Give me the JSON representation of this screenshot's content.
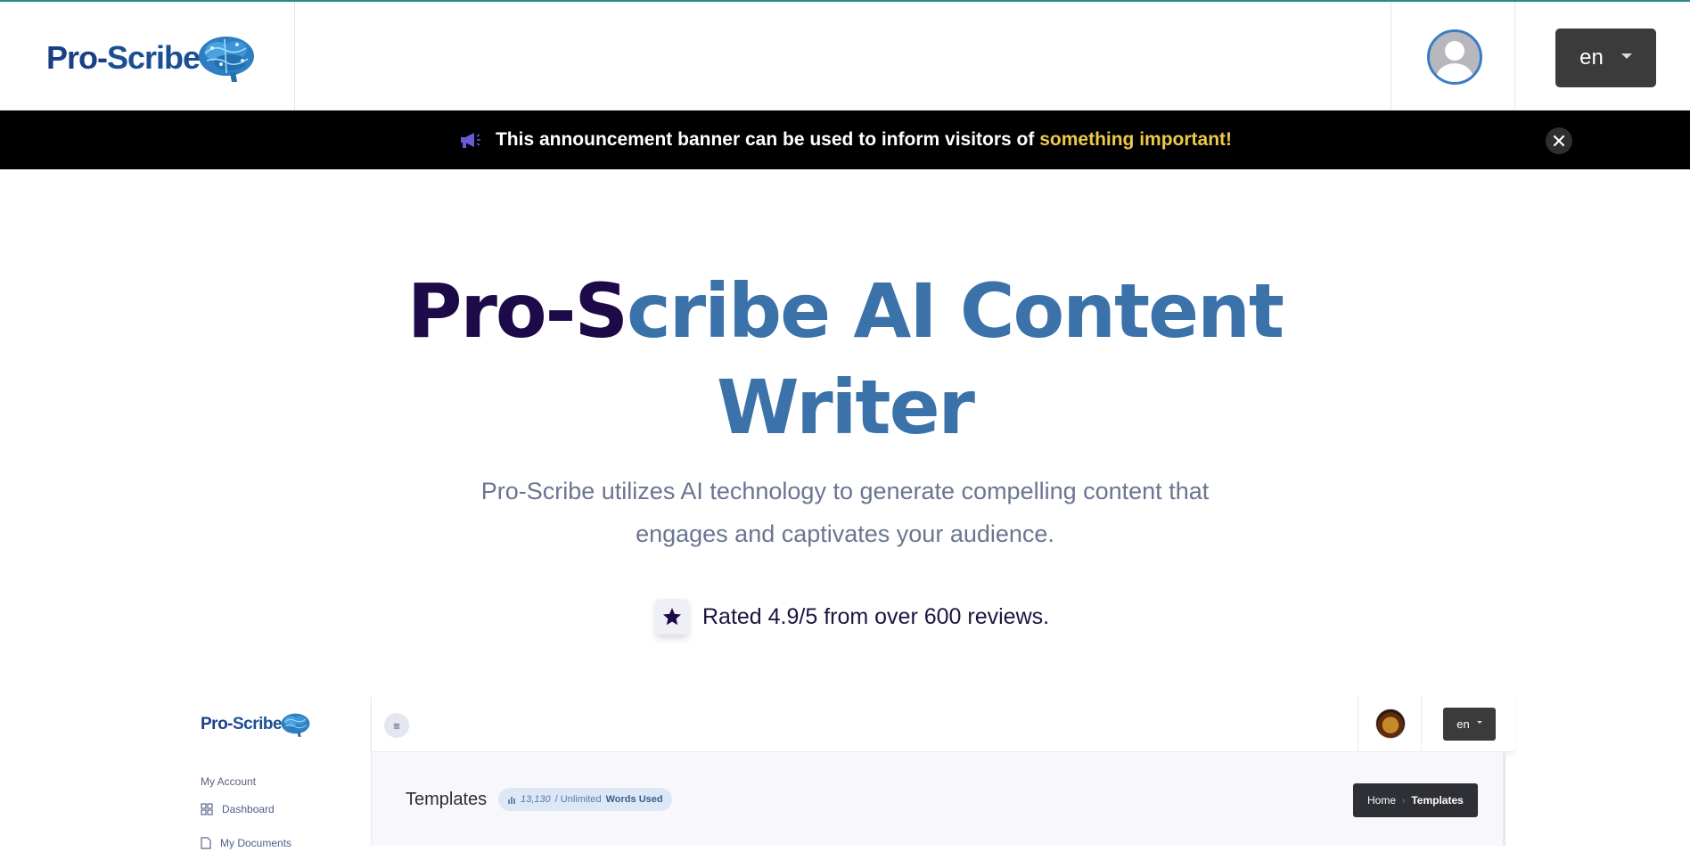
{
  "header": {
    "logo_part1": "Pro-",
    "logo_part2": "Scribe",
    "language": "en"
  },
  "banner": {
    "text": "This announcement banner can be used to inform visitors of",
    "highlight": "something important!",
    "highlight_color": "#ecc94b"
  },
  "hero": {
    "title_dark": "Pro-S",
    "title_blue": "cribe AI Content",
    "title_line2": "Writer",
    "subtitle": "Pro-Scribe utilizes AI technology to generate compelling content that engages and captivates your audience.",
    "rating": "Rated 4.9/5 from over 600 reviews."
  },
  "preview": {
    "logo_part1": "Pro-",
    "logo_part2": "Scribe",
    "language": "en",
    "sidebar_section": "My Account",
    "nav_dashboard": "Dashboard",
    "nav_documents": "My Documents",
    "page_title": "Templates",
    "words_used_count": "13,130",
    "words_used_limit": "/ Unlimited",
    "words_used_label": "Words Used",
    "breadcrumb_home": "Home",
    "breadcrumb_current": "Templates"
  },
  "colors": {
    "brand_dark": "#1c0a49",
    "brand_blue": "#3b72aa",
    "banner_bg": "#000000"
  }
}
